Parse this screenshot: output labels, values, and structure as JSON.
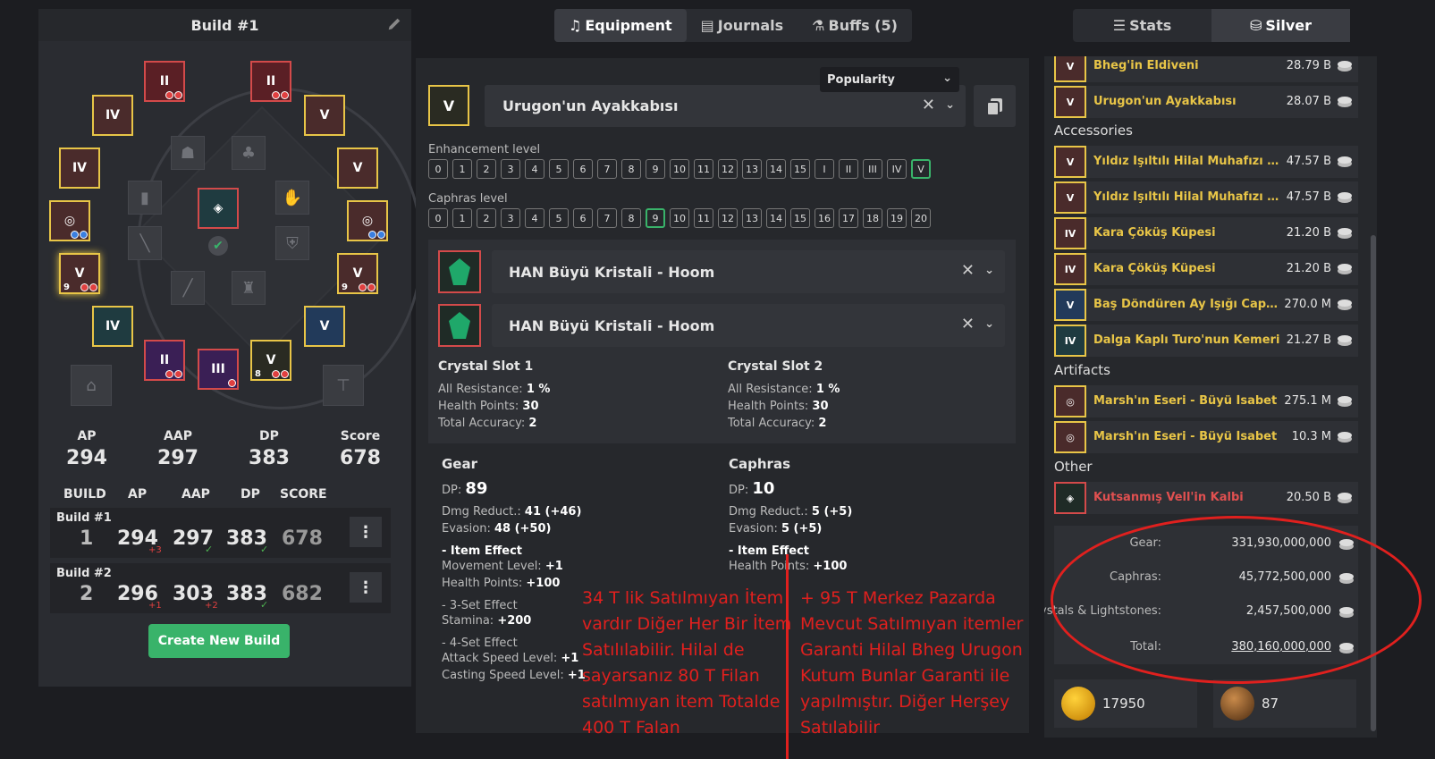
{
  "build_panel": {
    "title": "Build #1",
    "stats": [
      {
        "label": "AP",
        "value": "294"
      },
      {
        "label": "AAP",
        "value": "297"
      },
      {
        "label": "DP",
        "value": "383"
      },
      {
        "label": "Score",
        "value": "678"
      }
    ],
    "table_headers": [
      "BUILD",
      "AP",
      "AAP",
      "DP",
      "SCORE"
    ],
    "builds": [
      {
        "name": "Build #1",
        "index": "1",
        "ap": "294",
        "ap_delta": "+3",
        "aap": "297",
        "dp": "383",
        "score": "678"
      },
      {
        "name": "Build #2",
        "index": "2",
        "ap": "296",
        "ap_delta": "+1",
        "aap": "303",
        "aap_delta": "+2",
        "dp": "383",
        "score": "682"
      }
    ],
    "create_button": "Create New Build",
    "slot_enhancements": {
      "s1": "II",
      "s2": "II",
      "s3": "IV",
      "s4": "V",
      "s5": "IV",
      "s6": "V",
      "s7": "V",
      "s7n": "9",
      "s8": "V",
      "s8n": "9",
      "s9": "IV",
      "s10": "V",
      "s11": "II",
      "s12": "III",
      "s13": "V",
      "s13n": "8"
    }
  },
  "top_tabs": {
    "equipment": "Equipment",
    "journals": "Journals",
    "buffs": "Buffs (5)"
  },
  "right_tabs": {
    "stats": "Stats",
    "silver": "Silver"
  },
  "equipment": {
    "popularity": "Popularity",
    "selected_item": "Urugon'un Ayakkabısı",
    "selected_grade": "V",
    "enhancement_label": "Enhancement level",
    "enhancement_levels": [
      "0",
      "1",
      "2",
      "3",
      "4",
      "5",
      "6",
      "7",
      "8",
      "9",
      "10",
      "11",
      "12",
      "13",
      "14",
      "15",
      "I",
      "II",
      "III",
      "IV",
      "V"
    ],
    "enhancement_selected": "V",
    "caphras_label": "Caphras level",
    "caphras_levels": [
      "0",
      "1",
      "2",
      "3",
      "4",
      "5",
      "6",
      "7",
      "8",
      "9",
      "10",
      "11",
      "12",
      "13",
      "14",
      "15",
      "16",
      "17",
      "18",
      "19",
      "20"
    ],
    "caphras_selected": "9",
    "crystals": [
      "HAN Büyü Kristali - Hoom",
      "HAN Büyü Kristali - Hoom"
    ],
    "crystal_slots": [
      {
        "title": "Crystal Slot 1",
        "lines": [
          {
            "k": "All Resistance:",
            "v": "1 %"
          },
          {
            "k": "Health Points:",
            "v": "30"
          },
          {
            "k": "Total Accuracy:",
            "v": "2"
          }
        ]
      },
      {
        "title": "Crystal Slot 2",
        "lines": [
          {
            "k": "All Resistance:",
            "v": "1 %"
          },
          {
            "k": "Health Points:",
            "v": "30"
          },
          {
            "k": "Total Accuracy:",
            "v": "2"
          }
        ]
      }
    ],
    "gear": {
      "title": "Gear",
      "dp_label": "DP:",
      "dp": "89",
      "dmg_reduct": "Dmg Reduct.:",
      "dmg_reduct_v": "41 (+46)",
      "evasion": "Evasion:",
      "evasion_v": "48 (+50)",
      "item_effect": "- Item Effect",
      "movement": "Movement Level:",
      "movement_v": "+1",
      "hp": "Health Points:",
      "hp_v": "+100",
      "set3": "- 3-Set Effect",
      "stamina": "Stamina:",
      "stamina_v": "+200",
      "set4": "- 4-Set Effect",
      "atk_speed": "Attack Speed Level:",
      "atk_speed_v": "+1",
      "cast_speed": "Casting Speed Level:",
      "cast_speed_v": "+1"
    },
    "caphras": {
      "title": "Caphras",
      "dp_label": "DP:",
      "dp": "10",
      "dmg_reduct": "Dmg Reduct.:",
      "dmg_reduct_v": "5 (+5)",
      "evasion": "Evasion:",
      "evasion_v": "5 (+5)",
      "item_effect": "- Item Effect",
      "hp": "Health Points:",
      "hp_v": "+100"
    }
  },
  "silver": {
    "items_top": [
      {
        "grade": "V",
        "name": "Bheg'in Eldiveni",
        "price": "28.79 B"
      },
      {
        "grade": "V",
        "name": "Urugon'un Ayakkabısı",
        "price": "28.07 B"
      }
    ],
    "accessories_title": "Accessories",
    "accessories": [
      {
        "grade": "V",
        "name": "Yıldız Işıltılı Hilal Muhafızı Yüz...",
        "price": "47.57 B"
      },
      {
        "grade": "V",
        "name": "Yıldız Işıltılı Hilal Muhafızı Yüz...",
        "price": "47.57 B"
      },
      {
        "grade": "IV",
        "name": "Kara Çöküş Küpesi",
        "price": "21.20 B"
      },
      {
        "grade": "IV",
        "name": "Kara Çöküş Küpesi",
        "price": "21.20 B"
      },
      {
        "grade": "V",
        "name": "Baş Döndüren Ay Işığı Capoti...",
        "price": "270.0 M"
      },
      {
        "grade": "IV",
        "name": "Dalga Kaplı Turo'nun Kemeri",
        "price": "21.27 B"
      }
    ],
    "artifacts_title": "Artifacts",
    "artifacts": [
      {
        "name": "Marsh'ın Eseri - Büyü İsabet",
        "price": "275.1 M"
      },
      {
        "name": "Marsh'ın Eseri - Büyü İsabet",
        "price": "10.3 M"
      }
    ],
    "other_title": "Other",
    "other": [
      {
        "name": "Kutsanmış Vell'in Kalbi",
        "price": "20.50 B"
      }
    ],
    "totals": [
      {
        "label": "Gear:",
        "value": "331,930,000,000"
      },
      {
        "label": "Caphras:",
        "value": "45,772,500,000"
      },
      {
        "label": "Crystals & Lightstones:",
        "value": "2,457,500,000"
      },
      {
        "label": "Total:",
        "value": "380,160,000,000"
      }
    ],
    "resources": [
      {
        "value": "17950"
      },
      {
        "value": "87"
      }
    ]
  },
  "annotations": {
    "left": [
      "34 T lik Satılmıyan İtem",
      "vardır Diğer Her Bir İtem",
      "Satılılabilir. Hilal de",
      "sayarsanız 80 T Filan",
      "satılmıyan item  Totalde",
      "400 T Falan"
    ],
    "right": [
      "+ 95 T Merkez Pazarda",
      "Mevcut  Satılmıyan itemler",
      "Garanti Hilal  Bheg Urugon",
      "Kutum  Bunlar Garanti ile",
      "yapılmıştır. Diğer Herşey",
      "Satılabilir"
    ],
    "color": "#e0201e"
  }
}
